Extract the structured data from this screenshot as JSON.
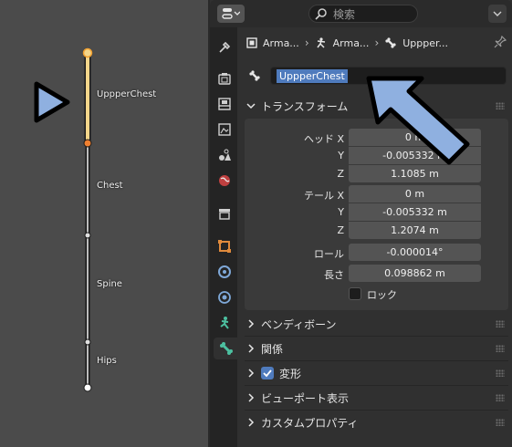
{
  "viewport": {
    "bones": [
      {
        "label": "UppperChest"
      },
      {
        "label": "Chest"
      },
      {
        "label": "Spine"
      },
      {
        "label": "Hips"
      }
    ]
  },
  "header": {
    "search_placeholder": "検索"
  },
  "breadcrumb": {
    "items": [
      "Arma...",
      "Arma...",
      "Uppper..."
    ]
  },
  "bone_name": "UppperChest",
  "transform": {
    "title": "トランスフォーム",
    "head_label": "ヘッド X",
    "y_label": "Y",
    "z_label": "Z",
    "tail_label": "テール X",
    "roll_label": "ロール",
    "length_label": "長さ",
    "lock_label": "ロック",
    "head": {
      "x": "0 m",
      "y": "-0.005332 m",
      "z": "1.1085 m"
    },
    "tail": {
      "x": "0 m",
      "y": "-0.005332 m",
      "z": "1.2074 m"
    },
    "roll": "-0.000014°",
    "length": "0.098862 m",
    "lock_checked": false
  },
  "panels": [
    {
      "title": "ベンディボーン",
      "has_checkbox": false
    },
    {
      "title": "関係",
      "has_checkbox": false
    },
    {
      "title": "変形",
      "has_checkbox": true,
      "checked": true
    },
    {
      "title": "ビューポート表示",
      "has_checkbox": false
    },
    {
      "title": "カスタムプロパティ",
      "has_checkbox": false
    }
  ],
  "colors": {
    "selected_bone": "#f5d68a",
    "bone_joint_active": "#f0a030",
    "accent_blue": "#4f7bbd",
    "annotation_arrow": "#8fb0e0"
  },
  "tabs": [
    "tool-icon",
    "render-icon",
    "output-icon",
    "view-layer-icon",
    "scene-icon",
    "world-icon",
    "collection-icon",
    "object-icon",
    "modifiers-icon",
    "physics-icon",
    "object-data-icon",
    "bone-icon"
  ]
}
